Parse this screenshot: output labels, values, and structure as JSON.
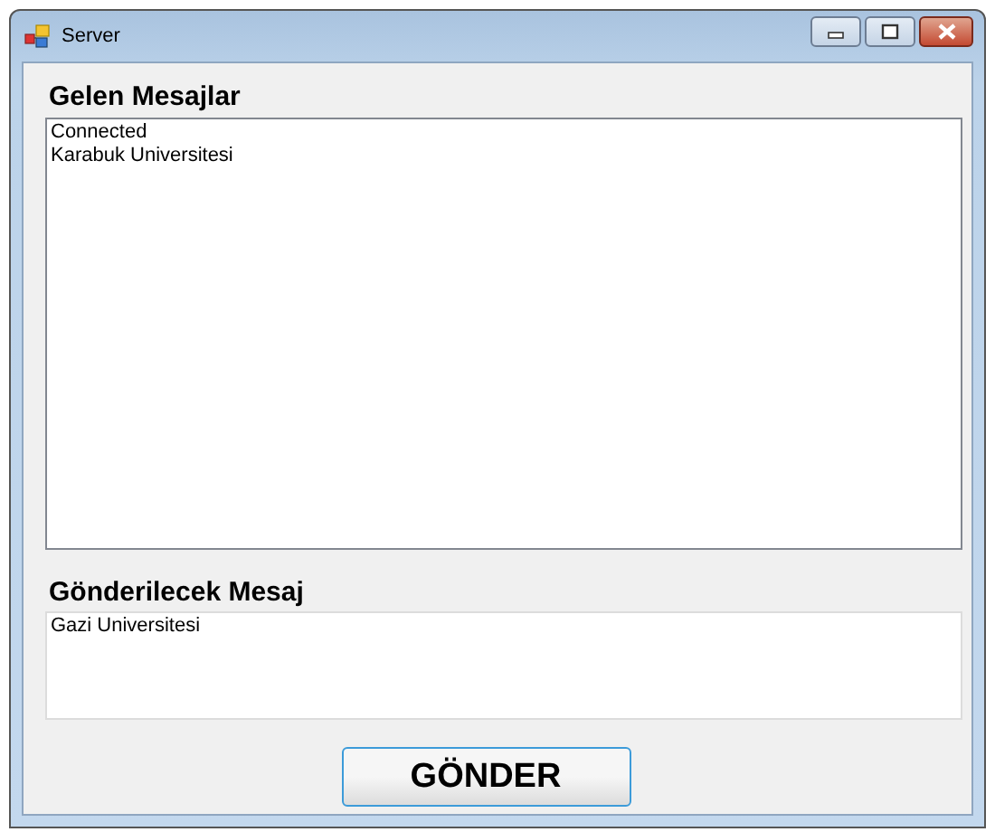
{
  "window": {
    "title": "Server"
  },
  "incoming": {
    "label": "Gelen Mesajlar",
    "lines": [
      "Connected",
      "Karabuk Universitesi"
    ]
  },
  "outgoing": {
    "label": "Gönderilecek Mesaj",
    "value": "Gazi Universitesi"
  },
  "send_button": {
    "label": "GÖNDER"
  }
}
